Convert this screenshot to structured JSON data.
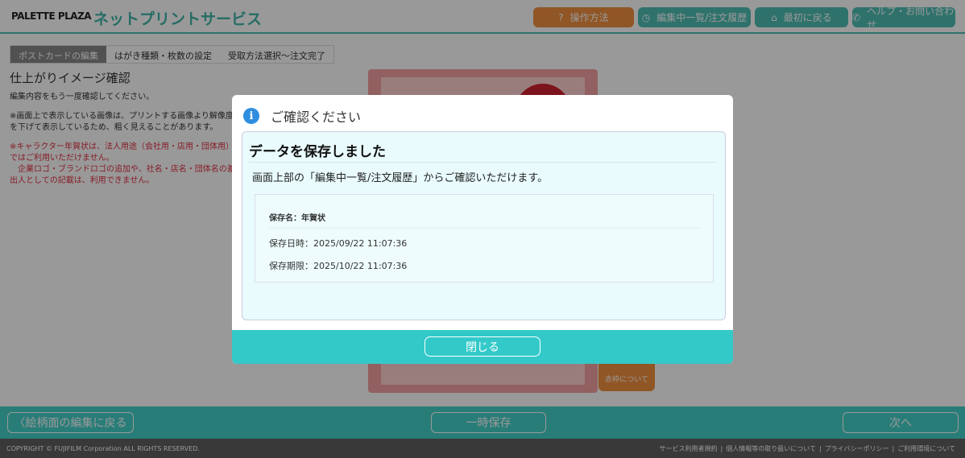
{
  "header": {
    "logo": "PALETTE PLAZA",
    "service": "ネットプリントサービス",
    "buttons": [
      {
        "label": "操作方法",
        "icon": "?"
      },
      {
        "label": "編集中一覧/注文履歴",
        "icon": "◷"
      },
      {
        "label": "最初に戻る",
        "icon": "⌂"
      },
      {
        "label": "ヘルプ・お問い合わせ",
        "icon": "✆"
      }
    ],
    "colors": {
      "accent": "#4fbfb5",
      "orange": "#f0903e"
    }
  },
  "breadcrumb": [
    "ポストカードの編集",
    "はがき種類・枚数の設定",
    "受取方法選択～注文完了"
  ],
  "main": {
    "title": "仕上がりイメージ確認",
    "intro": "編集内容をもう一度確認してください。",
    "note1": "※画面上で表示している画像は、プリントする画像より解像度を下げて表示しているため、粗く見えることがあります。",
    "note2": "※キャラクター年賀状は、法人用途（会社用・店用・団体用）ではご利用いただけません。",
    "note3": "企業ロゴ・ブランドロゴの追加や、社名・店名・団体名の差出人としての記載は、利用できません。",
    "redframe_label": "赤枠について"
  },
  "bottom": {
    "back": "絵柄面の編集に戻る",
    "save": "一時保存",
    "next": "次へ"
  },
  "footer": {
    "copyright": "COPYRIGHT © FUJIFILM Corporation ALL RIGHTS RESERVED.",
    "links": [
      "サービス利用者規約",
      "個人情報等の取り扱いについて",
      "プライバシーポリシー",
      "ご利用環境について"
    ]
  },
  "modal": {
    "title": "ご確認ください",
    "heading": "データを保存しました",
    "message": "画面上部の「編集中一覧/注文履歴」からご確認いただけます。",
    "save_name": "保存名：年賀状",
    "saved_at": "保存日時：2025/09/22 11:07:36",
    "expires": "保存期限：2025/10/22 11:07:36",
    "close": "閉じる"
  }
}
